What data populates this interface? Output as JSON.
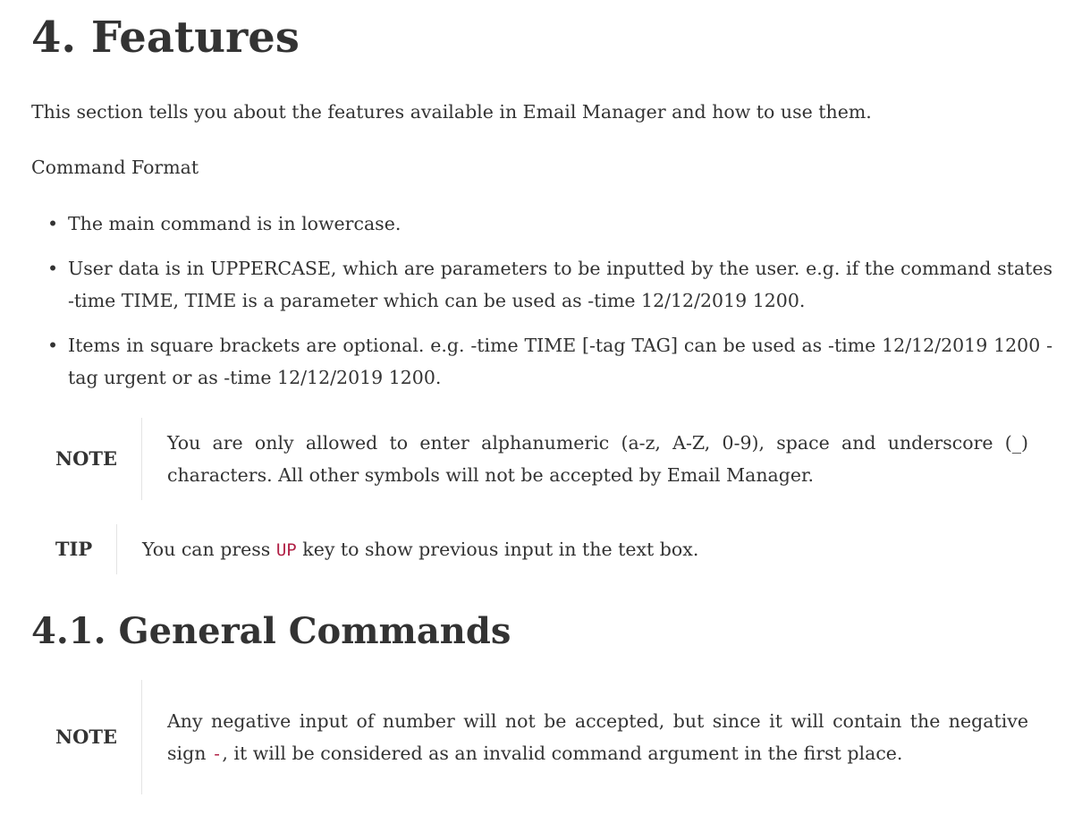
{
  "heading": "4. Features",
  "intro": "This section tells you about the features available in Email Manager and how to use them.",
  "command_format_title": "Command Format",
  "bullets": [
    "The main command is in lowercase.",
    "User data is in UPPERCASE, which are parameters to be inputted by the user. e.g. if the command states -time TIME, TIME is a parameter which can be used as -time 12/12/2019 1200.",
    "Items in square brackets are optional. e.g. -time TIME [-tag TAG] can be used as -time 12/12/2019 1200 -tag urgent or as -time 12/12/2019 1200."
  ],
  "note1": {
    "label": "NOTE",
    "text": "You are only allowed to enter alphanumeric (a-z, A-Z, 0-9), space and underscore (_) characters. All other symbols will not be accepted by Email Manager."
  },
  "tip": {
    "label": "TIP",
    "before": "You can press ",
    "code": "UP",
    "after": " key to show previous input in the text box."
  },
  "subheading": "4.1. General Commands",
  "note2": {
    "label": "NOTE",
    "before": "Any negative input of number will not be accepted, but since it will contain the negative sign ",
    "code": "-",
    "after": ", it will be considered as an invalid command argument in the first place."
  },
  "colors": {
    "text": "#333333",
    "code": "#b12146",
    "divider": "#e4e4e4"
  }
}
